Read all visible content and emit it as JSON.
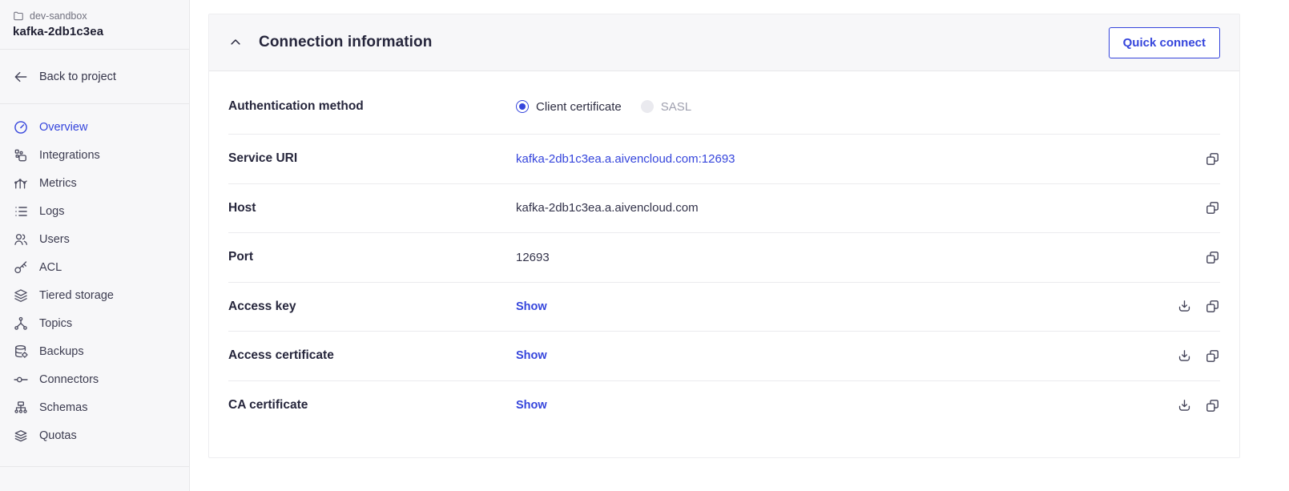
{
  "colors": {
    "accent": "#3545dc",
    "sidebar_bg": "#f7f7f9",
    "header_bg": "#f7f7f9",
    "border": "#e7e7ea"
  },
  "sidebar": {
    "project": "dev-sandbox",
    "service": "kafka-2db1c3ea",
    "back_label": "Back to project",
    "items": [
      {
        "label": "Overview",
        "icon": "gauge-icon",
        "active": true
      },
      {
        "label": "Integrations",
        "icon": "blocks-icon",
        "active": false
      },
      {
        "label": "Metrics",
        "icon": "chart-icon",
        "active": false
      },
      {
        "label": "Logs",
        "icon": "list-icon",
        "active": false
      },
      {
        "label": "Users",
        "icon": "users-icon",
        "active": false
      },
      {
        "label": "ACL",
        "icon": "key-icon",
        "active": false
      },
      {
        "label": "Tiered storage",
        "icon": "layers-icon",
        "active": false
      },
      {
        "label": "Topics",
        "icon": "graph-icon",
        "active": false
      },
      {
        "label": "Backups",
        "icon": "database-icon",
        "active": false
      },
      {
        "label": "Connectors",
        "icon": "connector-icon",
        "active": false
      },
      {
        "label": "Schemas",
        "icon": "tree-icon",
        "active": false
      },
      {
        "label": "Quotas",
        "icon": "stack-icon",
        "active": false
      }
    ]
  },
  "panel": {
    "title": "Connection information",
    "quick_connect_label": "Quick connect",
    "auth": {
      "label": "Authentication method",
      "options": [
        {
          "label": "Client certificate",
          "selected": true,
          "disabled": false
        },
        {
          "label": "SASL",
          "selected": false,
          "disabled": true
        }
      ]
    },
    "rows": [
      {
        "label": "Service URI",
        "value": "kafka-2db1c3ea.a.aivencloud.com:12693",
        "type": "link",
        "actions": [
          "copy-icon"
        ]
      },
      {
        "label": "Host",
        "value": "kafka-2db1c3ea.a.aivencloud.com",
        "type": "text",
        "actions": [
          "copy-icon"
        ]
      },
      {
        "label": "Port",
        "value": "12693",
        "type": "text",
        "actions": [
          "copy-icon"
        ]
      },
      {
        "label": "Access key",
        "value": "Show",
        "type": "show",
        "actions": [
          "download-icon",
          "copy-icon"
        ]
      },
      {
        "label": "Access certificate",
        "value": "Show",
        "type": "show",
        "actions": [
          "download-icon",
          "copy-icon"
        ]
      },
      {
        "label": "CA certificate",
        "value": "Show",
        "type": "show",
        "actions": [
          "download-icon",
          "copy-icon"
        ]
      }
    ]
  }
}
